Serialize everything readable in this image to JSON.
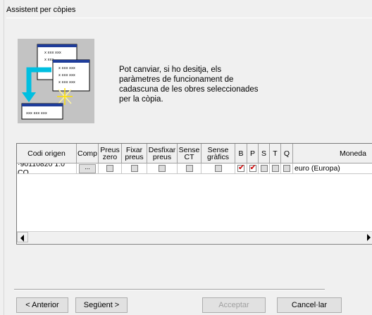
{
  "window": {
    "title": "Assistent per còpies"
  },
  "intro": {
    "text": "Pot canviar, si ho desitja, els\nparàmetres de funcionament de\ncadascuna de les obres seleccionades\nper la còpia."
  },
  "illustration": {
    "icon": "copy-wizard-illustration",
    "sheet_text": "xxx xxx xxx",
    "row_text": "x xxx xxx",
    "row_text_short": "x xxx"
  },
  "table": {
    "columns": [
      {
        "key": "codi",
        "label": "Codi origen"
      },
      {
        "key": "comp",
        "label": "Comp"
      },
      {
        "key": "preus_zero",
        "label": "Preus\nzero"
      },
      {
        "key": "fixar",
        "label": "Fixar\npreus"
      },
      {
        "key": "desfixar",
        "label": "Desfixar\npreus"
      },
      {
        "key": "sense_ct",
        "label": "Sense\nCT"
      },
      {
        "key": "sense_graf",
        "label": "Sense\ngràfics"
      },
      {
        "key": "b",
        "label": "B"
      },
      {
        "key": "p",
        "label": "P"
      },
      {
        "key": "s",
        "label": "S"
      },
      {
        "key": "t",
        "label": "T"
      },
      {
        "key": "q",
        "label": "Q"
      },
      {
        "key": "moneda",
        "label": "Moneda"
      }
    ],
    "rows": [
      {
        "codi": "·90110820 1.0 CO",
        "comp_button": "...",
        "checks": {
          "preus_zero": false,
          "fixar": false,
          "desfixar": false,
          "sense_ct": false,
          "sense_graf": false,
          "b": true,
          "p": true,
          "s": false,
          "t": false,
          "q": false
        },
        "moneda": "euro (Europa)"
      }
    ]
  },
  "buttons": {
    "back": "< Anterior",
    "next": "Següent >",
    "accept": "Acceptar",
    "cancel": "Cancel·lar"
  }
}
